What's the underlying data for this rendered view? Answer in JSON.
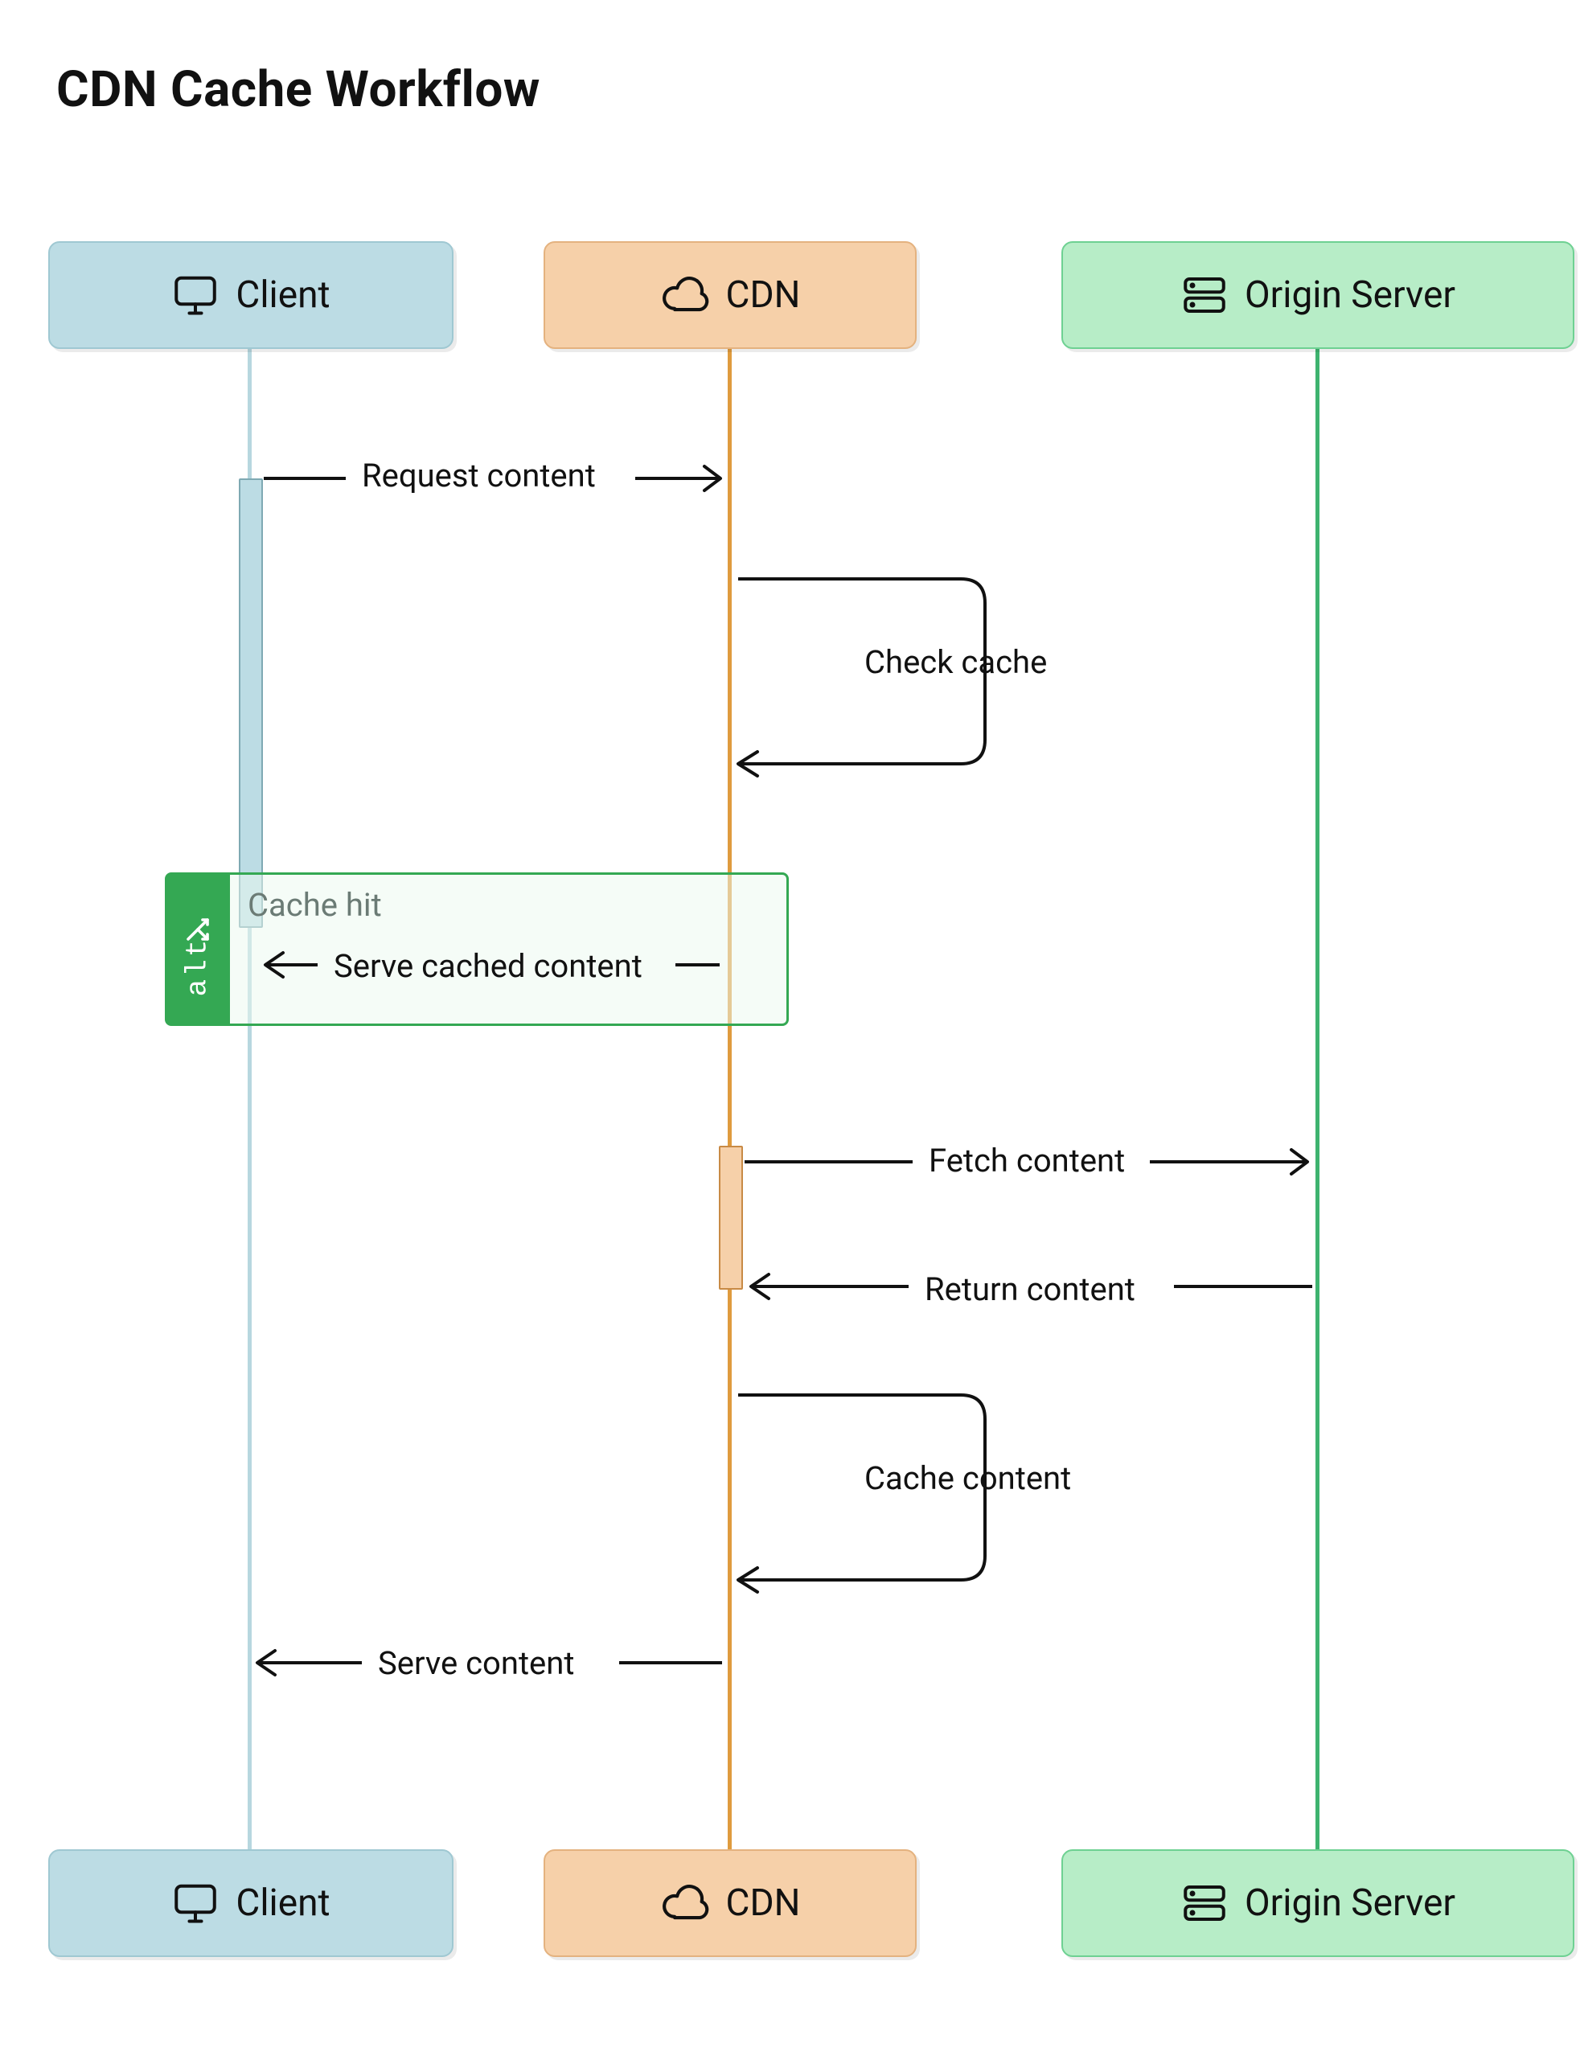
{
  "title": "CDN Cache Workflow",
  "participants": {
    "client": {
      "label": "Client",
      "icon": "monitor-icon",
      "color": "#bcdce4"
    },
    "cdn": {
      "label": "CDN",
      "icon": "cloud-icon",
      "color": "#f6d0a9"
    },
    "origin": {
      "label": "Origin Server",
      "icon": "server-icon",
      "color": "#b7edc7"
    }
  },
  "alt": {
    "tag": "alt",
    "guard": "Cache hit"
  },
  "messages": {
    "m1": "Request content",
    "m2": "Check cache",
    "m3": "Serve cached content",
    "m4": "Fetch content",
    "m5": "Return content",
    "m6": "Cache content",
    "m7": "Serve content"
  },
  "chart_data": {
    "type": "sequence-diagram",
    "title": "CDN Cache Workflow",
    "participants": [
      "Client",
      "CDN",
      "Origin Server"
    ],
    "steps": [
      {
        "from": "Client",
        "to": "CDN",
        "label": "Request content",
        "kind": "async"
      },
      {
        "from": "CDN",
        "to": "CDN",
        "label": "Check cache",
        "kind": "self-async"
      },
      {
        "alt": {
          "guard": "Cache hit",
          "steps": [
            {
              "from": "CDN",
              "to": "Client",
              "label": "Serve cached content",
              "kind": "async"
            }
          ],
          "else": [
            {
              "from": "CDN",
              "to": "Origin Server",
              "label": "Fetch content",
              "kind": "async"
            },
            {
              "from": "Origin Server",
              "to": "CDN",
              "label": "Return content",
              "kind": "async"
            },
            {
              "from": "CDN",
              "to": "CDN",
              "label": "Cache content",
              "kind": "self-async"
            },
            {
              "from": "CDN",
              "to": "Client",
              "label": "Serve content",
              "kind": "async"
            }
          ]
        }
      }
    ]
  }
}
